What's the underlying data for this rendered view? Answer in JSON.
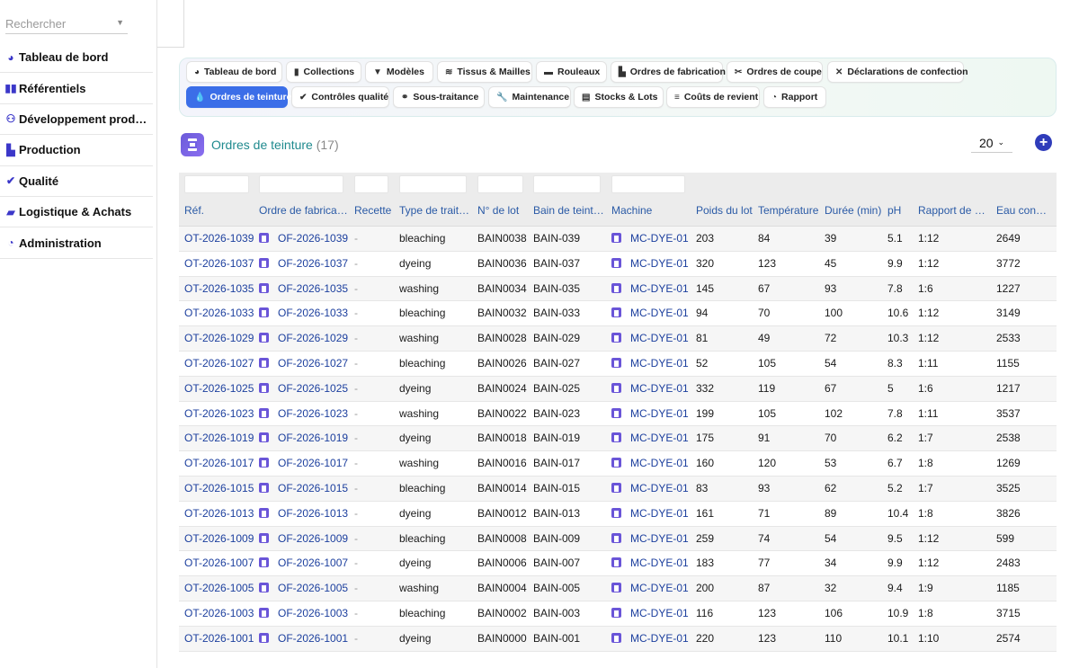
{
  "sidebar": {
    "search_placeholder": "Rechercher",
    "items": [
      {
        "label": "Tableau de bord",
        "icon": "gauge-icon"
      },
      {
        "label": "Référentiels",
        "icon": "book-icon"
      },
      {
        "label": "Développement prod…",
        "icon": "people-icon"
      },
      {
        "label": "Production",
        "icon": "factory-icon"
      },
      {
        "label": "Qualité",
        "icon": "check-circle-icon"
      },
      {
        "label": "Logistique & Achats",
        "icon": "truck-icon"
      },
      {
        "label": "Administration",
        "icon": "pie-chart-icon"
      }
    ]
  },
  "tabs": [
    {
      "label": "Tableau de bord",
      "icon": "gauge-icon",
      "active": false
    },
    {
      "label": "Collections",
      "icon": "book-icon",
      "active": false
    },
    {
      "label": "Modèles",
      "icon": "shirt-icon",
      "active": false
    },
    {
      "label": "Tissus & Mailles",
      "icon": "layers-icon",
      "active": false
    },
    {
      "label": "Rouleaux",
      "icon": "roll-icon",
      "active": false
    },
    {
      "label": "Ordres de fabrication",
      "icon": "factory-icon",
      "active": false
    },
    {
      "label": "Ordres de coupe",
      "icon": "scissors-icon",
      "active": false
    },
    {
      "label": "Déclarations de confection",
      "icon": "tools-icon",
      "active": false
    },
    {
      "label": "Ordres de teinture",
      "icon": "droplet-icon",
      "active": true
    },
    {
      "label": "Contrôles qualité",
      "icon": "check-circle-icon",
      "active": false
    },
    {
      "label": "Sous-traitance",
      "icon": "handshake-icon",
      "active": false
    },
    {
      "label": "Maintenance",
      "icon": "wrench-icon",
      "active": false
    },
    {
      "label": "Stocks & Lots",
      "icon": "warehouse-icon",
      "active": false
    },
    {
      "label": "Coûts de revient",
      "icon": "coins-icon",
      "active": false
    },
    {
      "label": "Rapport",
      "icon": "pie-chart-icon",
      "active": false
    }
  ],
  "header": {
    "title": "Ordres de teinture",
    "count": "(17)",
    "page_size": "20"
  },
  "table": {
    "columns": [
      "Réf.",
      "Ordre de fabrica…",
      "Recette",
      "Type de trait…",
      "N° de lot",
      "Bain de teint…",
      "Machine",
      "Poids du lot",
      "Température",
      "Durée (min)",
      "pH",
      "Rapport de b…",
      "Eau consom…"
    ],
    "rows": [
      [
        "OT-2026-1039",
        "OF-2026-1039",
        "-",
        "bleaching",
        "BAIN0038",
        "BAIN-039",
        "MC-DYE-01",
        "203",
        "84",
        "39",
        "5.1",
        "1:12",
        "2649"
      ],
      [
        "OT-2026-1037",
        "OF-2026-1037",
        "-",
        "dyeing",
        "BAIN0036",
        "BAIN-037",
        "MC-DYE-01",
        "320",
        "123",
        "45",
        "9.9",
        "1:12",
        "3772"
      ],
      [
        "OT-2026-1035",
        "OF-2026-1035",
        "-",
        "washing",
        "BAIN0034",
        "BAIN-035",
        "MC-DYE-01",
        "145",
        "67",
        "93",
        "7.8",
        "1:6",
        "1227"
      ],
      [
        "OT-2026-1033",
        "OF-2026-1033",
        "-",
        "bleaching",
        "BAIN0032",
        "BAIN-033",
        "MC-DYE-01",
        "94",
        "70",
        "100",
        "10.6",
        "1:12",
        "3149"
      ],
      [
        "OT-2026-1029",
        "OF-2026-1029",
        "-",
        "washing",
        "BAIN0028",
        "BAIN-029",
        "MC-DYE-01",
        "81",
        "49",
        "72",
        "10.3",
        "1:12",
        "2533"
      ],
      [
        "OT-2026-1027",
        "OF-2026-1027",
        "-",
        "bleaching",
        "BAIN0026",
        "BAIN-027",
        "MC-DYE-01",
        "52",
        "105",
        "54",
        "8.3",
        "1:11",
        "1155"
      ],
      [
        "OT-2026-1025",
        "OF-2026-1025",
        "-",
        "dyeing",
        "BAIN0024",
        "BAIN-025",
        "MC-DYE-01",
        "332",
        "119",
        "67",
        "5",
        "1:6",
        "1217"
      ],
      [
        "OT-2026-1023",
        "OF-2026-1023",
        "-",
        "washing",
        "BAIN0022",
        "BAIN-023",
        "MC-DYE-01",
        "199",
        "105",
        "102",
        "7.8",
        "1:11",
        "3537"
      ],
      [
        "OT-2026-1019",
        "OF-2026-1019",
        "-",
        "dyeing",
        "BAIN0018",
        "BAIN-019",
        "MC-DYE-01",
        "175",
        "91",
        "70",
        "6.2",
        "1:7",
        "2538"
      ],
      [
        "OT-2026-1017",
        "OF-2026-1017",
        "-",
        "washing",
        "BAIN0016",
        "BAIN-017",
        "MC-DYE-01",
        "160",
        "120",
        "53",
        "6.7",
        "1:8",
        "1269"
      ],
      [
        "OT-2026-1015",
        "OF-2026-1015",
        "-",
        "bleaching",
        "BAIN0014",
        "BAIN-015",
        "MC-DYE-01",
        "83",
        "93",
        "62",
        "5.2",
        "1:7",
        "3525"
      ],
      [
        "OT-2026-1013",
        "OF-2026-1013",
        "-",
        "dyeing",
        "BAIN0012",
        "BAIN-013",
        "MC-DYE-01",
        "161",
        "71",
        "89",
        "10.4",
        "1:8",
        "3826"
      ],
      [
        "OT-2026-1009",
        "OF-2026-1009",
        "-",
        "bleaching",
        "BAIN0008",
        "BAIN-009",
        "MC-DYE-01",
        "259",
        "74",
        "54",
        "9.5",
        "1:12",
        "599"
      ],
      [
        "OT-2026-1007",
        "OF-2026-1007",
        "-",
        "dyeing",
        "BAIN0006",
        "BAIN-007",
        "MC-DYE-01",
        "183",
        "77",
        "34",
        "9.9",
        "1:12",
        "2483"
      ],
      [
        "OT-2026-1005",
        "OF-2026-1005",
        "-",
        "washing",
        "BAIN0004",
        "BAIN-005",
        "MC-DYE-01",
        "200",
        "87",
        "32",
        "9.4",
        "1:9",
        "1185"
      ],
      [
        "OT-2026-1003",
        "OF-2026-1003",
        "-",
        "bleaching",
        "BAIN0002",
        "BAIN-003",
        "MC-DYE-01",
        "116",
        "123",
        "106",
        "10.9",
        "1:8",
        "3715"
      ],
      [
        "OT-2026-1001",
        "OF-2026-1001",
        "-",
        "dyeing",
        "BAIN0000",
        "BAIN-001",
        "MC-DYE-01",
        "220",
        "123",
        "110",
        "10.1",
        "1:10",
        "2574"
      ]
    ]
  },
  "colors": {
    "accent": "#3b6ee8",
    "link": "#1c3f9e",
    "title": "#1f8a8e",
    "icon": "#3b37c9"
  }
}
